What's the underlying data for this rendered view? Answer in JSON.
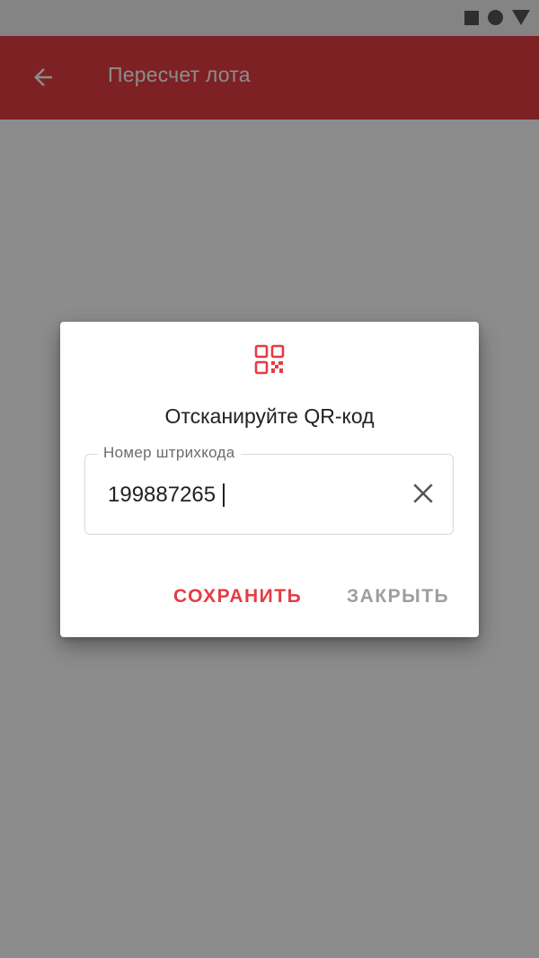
{
  "app_bar": {
    "title": "Пересчет лота",
    "back_icon": "arrow-left-icon",
    "color": "#e43c44"
  },
  "status_bar": {
    "icons": [
      "square-icon",
      "circle-icon",
      "triangle-icon"
    ]
  },
  "dialog": {
    "icon": "qr-code-icon",
    "title": "Отсканируйте QR-код",
    "field": {
      "label": "Номер штрихкода",
      "value": "199887265",
      "clear_icon": "close-icon"
    },
    "save_label": "СОХРАНИТЬ",
    "close_label": "ЗАКРЫТЬ"
  },
  "colors": {
    "accent": "#e43c44",
    "secondary_text": "#9e9e9e"
  }
}
